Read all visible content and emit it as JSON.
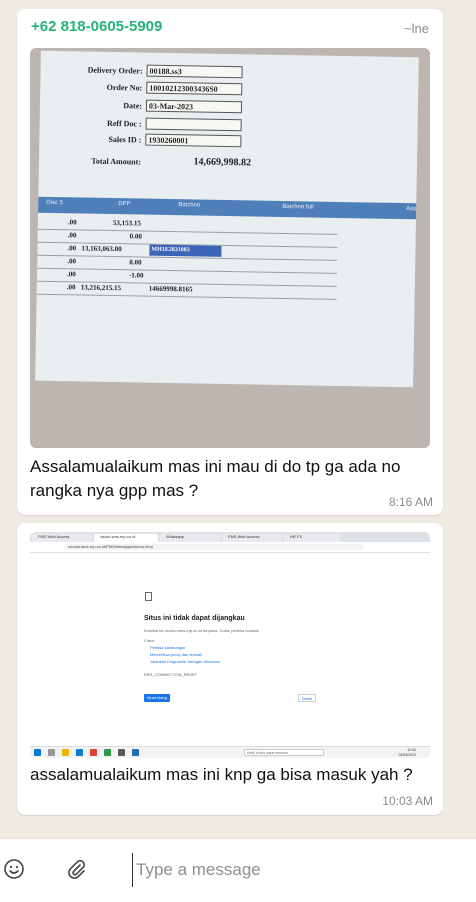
{
  "chat": {
    "messages": [
      {
        "sender": "+62 818-0605-5909",
        "pushname": "~lne",
        "caption": "Assalamualaikum mas ini mau di do tp ga ada no rangka nya gpp mas ?",
        "time": "8:16 AM",
        "photo": {
          "fields": {
            "delivery_order_label": "Delivery Order:",
            "delivery_order": "00188.ss3",
            "order_no_label": "Order No:",
            "order_no": "100102123003436S0",
            "date_label": "Date:",
            "date": "03-Mar-2023",
            "reff_doc_label": "Reff Doc :",
            "sales_id_label": "Sales ID :",
            "sales_id": "1930260001",
            "total_amount_label": "Total Amount:",
            "total_amount": "14,669,998.82"
          },
          "table": {
            "headers": [
              "Disc 5",
              "DPP",
              "Batchno",
              "Batchno full",
              "Ass"
            ],
            "rows": [
              [
                ".00",
                "53,153.15",
                ""
              ],
              [
                ".00",
                "0.00",
                ""
              ],
              [
                ".00",
                "13,163,063.00",
                "MH1E2831083"
              ],
              [
                ".00",
                "0.00",
                ""
              ],
              [
                ".00",
                "-1.00",
                ""
              ],
              [
                ".00",
                "13,216,215.15",
                "14669998.8165"
              ]
            ]
          }
        }
      },
      {
        "caption": "assalamualaikum mas ini knp ga bisa masuk yah ?",
        "time": "10:03 AM",
        "photo": {
          "tabs": [
            "FMS Web Access",
            "vision.sms-erp.co.id",
            "Whatsapp",
            "FMS Web Access",
            "HR FS"
          ],
          "url": "vendor.sms-erp.co.id/FMS/sfmsapps/menu.html",
          "error_title": "Situs ini tidak dapat dijangkau",
          "error_detail": "Koneksi ke vendor.sms-erp.co.id terputus. Coba: periksa koneksi",
          "error_try": "Coba:",
          "error_links": [
            "Periksa sambungan",
            "Memeriksa proxy dan firewall",
            "Jalankan Diagnostik Jaringan Windows"
          ],
          "error_code": "ERR_CONNECTION_RESET",
          "reload": "Muat ulang",
          "details": "Detail",
          "taskbar_search": "Ketik di sini untuk mencari",
          "clock_time": "10:02",
          "clock_date": "03/03/2023"
        }
      }
    ]
  },
  "composer": {
    "placeholder": "Type a message",
    "emoji_icon": "smiley-icon",
    "attach_icon": "paperclip-icon"
  },
  "colors": {
    "sender": "#25b37a",
    "chat_bg": "#efeae2",
    "bubble": "#ffffff"
  }
}
